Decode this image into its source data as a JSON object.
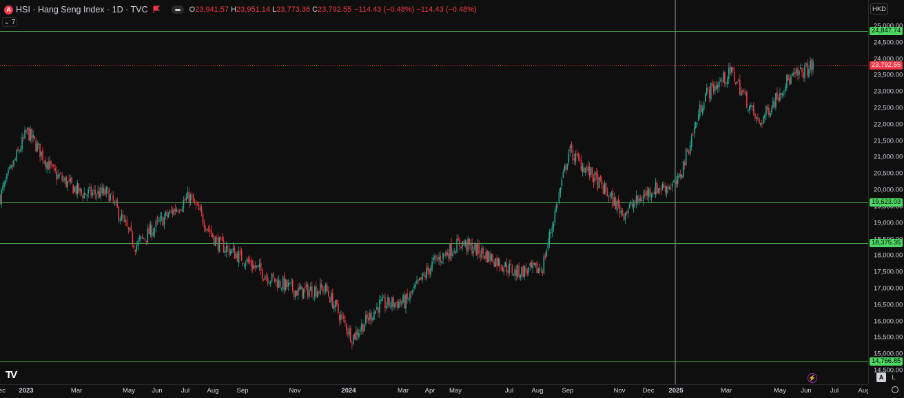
{
  "legend": {
    "symbol_badge": "A",
    "title": "HSI · Hang Seng Index · 1D · TVC",
    "ohlc": [
      {
        "k": "O",
        "v": "23,941.57"
      },
      {
        "k": "H",
        "v": "23,951.14"
      },
      {
        "k": "L",
        "v": "23,773.36"
      },
      {
        "k": "C",
        "v": "23,792.55"
      }
    ],
    "change": "−114.43 (−0.48%)  −114.43 (−0.48%)",
    "indicators_toggle": "⌄ 7"
  },
  "currency": "HKD",
  "price_axis": [
    "25,000.00",
    "24,500.00",
    "24,000.00",
    "23,500.00",
    "23,000.00",
    "22,500.00",
    "22,000.00",
    "21,500.00",
    "21,000.00",
    "20,500.00",
    "20,000.00",
    "19,500.00",
    "19,000.00",
    "18,500.00",
    "18,000.00",
    "17,500.00",
    "17,000.00",
    "16,500.00",
    "16,000.00",
    "15,500.00",
    "15,000.00",
    "14,500.00"
  ],
  "horizontal_lines": [
    {
      "label": "24,847.74",
      "price": 24847.74
    },
    {
      "label": "19,623.03",
      "price": 19623.03
    },
    {
      "label": "18,375.35",
      "price": 18375.35
    },
    {
      "label": "14,766.85",
      "price": 14766.85
    }
  ],
  "last_price": {
    "label": "23,792.55",
    "price": 23792.55
  },
  "time_axis": [
    "ec",
    "2023",
    "Mar",
    "May",
    "Jun",
    "Jul",
    "Aug",
    "Sep",
    "Nov",
    "2024",
    "Mar",
    "Apr",
    "May",
    "Jul",
    "Aug",
    "Sep",
    "Nov",
    "Dec",
    "2025",
    "Mar",
    "May",
    "Jun",
    "Jul",
    "Aug"
  ],
  "bottom_controls": {
    "auto": "A",
    "log": "L",
    "bolt": "⚡"
  },
  "colors": {
    "up": "#22ab94",
    "down": "#f23645",
    "hline": "#4caf50",
    "background": "#0f0f0f"
  },
  "chart_data": {
    "type": "candlestick",
    "title": "HSI · Hang Seng Index · 1D · TVC",
    "ylim": [
      14500,
      25000
    ],
    "x": [
      "Dec 2022",
      "Jan 2023",
      "Feb 2023",
      "Mar 2023",
      "Apr 2023",
      "May 2023",
      "Jun 2023",
      "Jul 2023",
      "Aug 2023",
      "Sep 2023",
      "Oct 2023",
      "Nov 2023",
      "Dec 2023",
      "Jan 2024",
      "Feb 2024",
      "Mar 2024",
      "Apr 2024",
      "May 2024",
      "Jun 2024",
      "Jul 2024",
      "Aug 2024",
      "Sep 2024",
      "Oct 2024",
      "Nov 2024",
      "Dec 2024",
      "Jan 2025",
      "Feb 2025",
      "Mar 2025",
      "Apr 2025",
      "May 2025",
      "Jun 2025"
    ],
    "close": [
      19800,
      21800,
      20500,
      19900,
      19900,
      18300,
      19100,
      19800,
      18400,
      17900,
      17300,
      16900,
      17000,
      15500,
      16500,
      16600,
      17800,
      18400,
      18000,
      17500,
      17600,
      21200,
      20300,
      19300,
      20000,
      20200,
      22900,
      23600,
      22000,
      23300,
      23792.55
    ],
    "key_levels": [
      24847.74,
      19623.03,
      18375.35,
      14766.85
    ]
  }
}
